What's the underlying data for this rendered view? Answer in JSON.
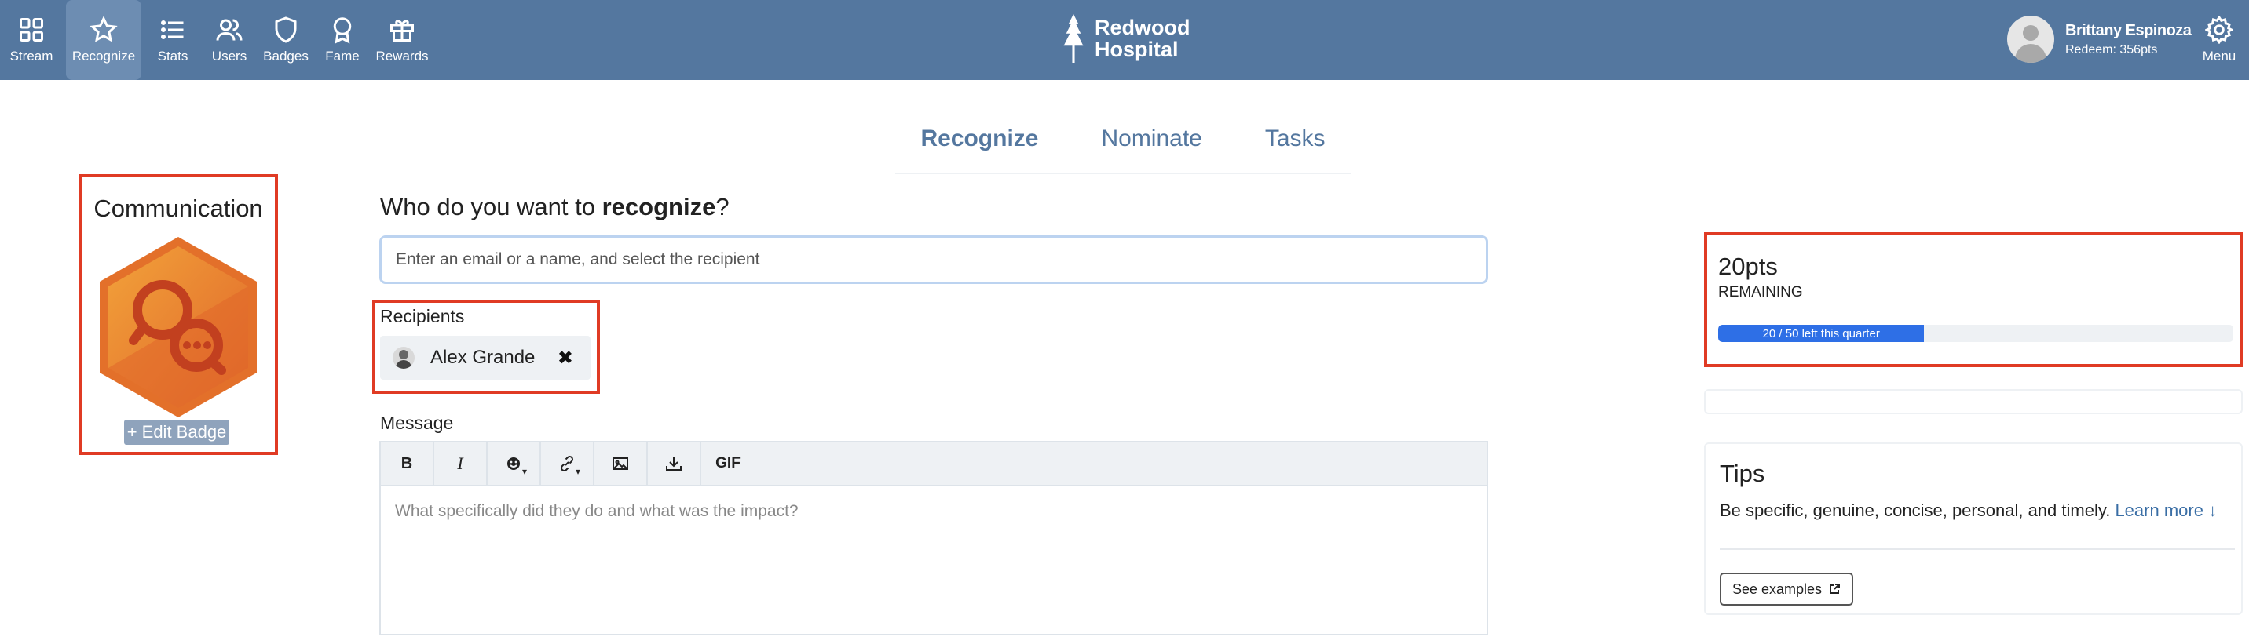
{
  "nav": {
    "items": [
      {
        "label": "Stream",
        "icon": "grid-icon"
      },
      {
        "label": "Recognize",
        "icon": "star-icon"
      },
      {
        "label": "Stats",
        "icon": "list-icon"
      },
      {
        "label": "Users",
        "icon": "users-icon"
      },
      {
        "label": "Badges",
        "icon": "shield-icon"
      },
      {
        "label": "Fame",
        "icon": "award-icon"
      },
      {
        "label": "Rewards",
        "icon": "gift-icon"
      }
    ],
    "active": "Recognize"
  },
  "brand": {
    "line1": "Redwood",
    "line2": "Hospital"
  },
  "user": {
    "name": "Brittany Espinoza",
    "points": "Redeem: 356pts"
  },
  "menu": {
    "label": "Menu"
  },
  "tabs": [
    "Recognize",
    "Nominate",
    "Tasks"
  ],
  "badge": {
    "title": "Communication",
    "edit_label": "+ Edit Badge",
    "icon": "chat-search-badge-icon"
  },
  "form": {
    "question_prefix": "Who do you want to ",
    "question_bold": "recognize",
    "question_suffix": "?",
    "search_placeholder": "Enter an email or a name, and select the recipient",
    "recipients_label": "Recipients",
    "recipient_name": "Alex Grande",
    "remove_symbol": "✖",
    "message_label": "Message",
    "toolbar": {
      "bold": "B",
      "italic": "I",
      "gif": "GIF"
    },
    "message_placeholder": "What specifically did they do and what was the impact?"
  },
  "points": {
    "value": "20pts",
    "remaining_label": "REMAINING",
    "bar_text": "20 / 50 left this quarter",
    "fraction": 0.4,
    "bar_color": "#2e6fe6"
  },
  "tips": {
    "title": "Tips",
    "text": "Be specific, genuine, concise, personal, and timely.",
    "learn_more": "Learn more",
    "learn_arrow": "↓",
    "examples_label": "See examples"
  },
  "colors": {
    "topbar": "#54779f",
    "highlight": "#e03b24",
    "badge_orange": "#e3702a"
  }
}
